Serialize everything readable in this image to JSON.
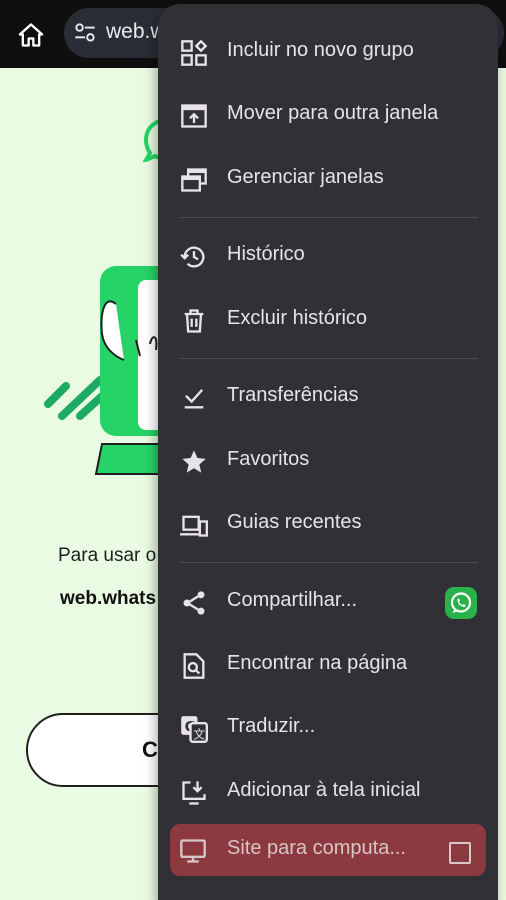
{
  "browser": {
    "url_text": "web.wh",
    "icons": {
      "home": "home-icon",
      "site_settings": "site-settings-icon"
    }
  },
  "page": {
    "instruction_text": "Para usar o",
    "domain_text": "web.whats",
    "button_label": "C"
  },
  "menu": {
    "items": [
      {
        "label": "Incluir no novo grupo",
        "icon": "new-tab-group-icon"
      },
      {
        "label": "Mover para outra janela",
        "icon": "move-window-icon"
      },
      {
        "label": "Gerenciar janelas",
        "icon": "manage-windows-icon"
      },
      {
        "label": "Histórico",
        "icon": "history-icon"
      },
      {
        "label": "Excluir histórico",
        "icon": "trash-icon"
      },
      {
        "label": "Transferências",
        "icon": "downloads-icon"
      },
      {
        "label": "Favoritos",
        "icon": "star-icon"
      },
      {
        "label": "Guias recentes",
        "icon": "recent-tabs-icon"
      },
      {
        "label": "Compartilhar...",
        "icon": "share-icon"
      },
      {
        "label": "Encontrar na página",
        "icon": "find-in-page-icon"
      },
      {
        "label": "Traduzir...",
        "icon": "translate-icon"
      },
      {
        "label": "Adicionar à tela inicial",
        "icon": "add-to-home-screen-icon"
      },
      {
        "label": "Site para computa...",
        "icon": "desktop-icon",
        "checked": false
      }
    ]
  },
  "colors": {
    "menu_bg": "#313135",
    "highlight": "#8c3a3f",
    "whatsapp_green": "#25d366",
    "page_bg": "#eafbe3"
  }
}
